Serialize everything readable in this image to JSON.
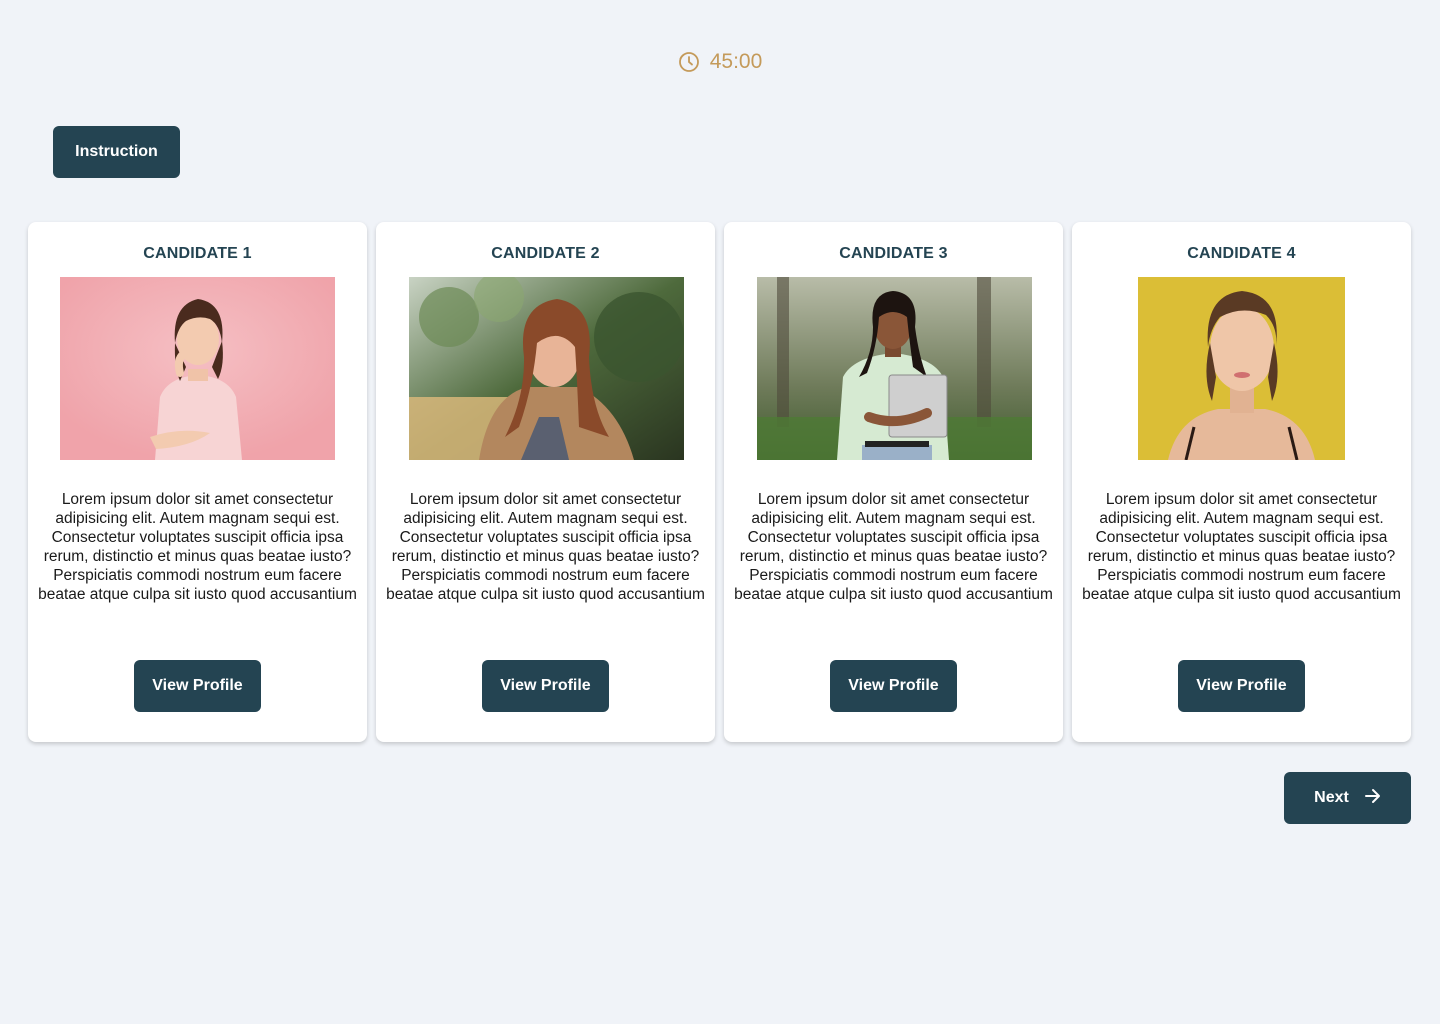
{
  "timer": {
    "icon": "clock-icon",
    "value": "45:00",
    "color": "#c49a5a"
  },
  "instruction_label": "Instruction",
  "candidates": [
    {
      "title": "CANDIDATE 1",
      "description": "Lorem ipsum dolor sit amet consectetur adipisicing elit. Autem magnam sequi est. Consectetur voluptates suscipit officia ipsa rerum, distinctio et minus quas beatae iusto? Perspiciatis commodi nostrum eum facere beatae atque culpa sit iusto quod accusantium",
      "button_label": "View Profile"
    },
    {
      "title": "CANDIDATE 2",
      "description": "Lorem ipsum dolor sit amet consectetur adipisicing elit. Autem magnam sequi est. Consectetur voluptates suscipit officia ipsa rerum, distinctio et minus quas beatae iusto? Perspiciatis commodi nostrum eum facere beatae atque culpa sit iusto quod accusantium",
      "button_label": "View Profile"
    },
    {
      "title": "CANDIDATE 3",
      "description": "Lorem ipsum dolor sit amet consectetur adipisicing elit. Autem magnam sequi est. Consectetur voluptates suscipit officia ipsa rerum, distinctio et minus quas beatae iusto? Perspiciatis commodi nostrum eum facere beatae atque culpa sit iusto quod accusantium",
      "button_label": "View Profile"
    },
    {
      "title": "CANDIDATE 4",
      "description": "Lorem ipsum dolor sit amet consectetur adipisicing elit. Autem magnam sequi est. Consectetur voluptates suscipit officia ipsa rerum, distinctio et minus quas beatae iusto? Perspiciatis commodi nostrum eum facere beatae atque culpa sit iusto quod accusantium",
      "button_label": "View Profile"
    }
  ],
  "next_label": "Next",
  "next_icon": "arrow-right-icon",
  "colors": {
    "primary_button": "#244452",
    "background": "#f0f3f8"
  }
}
